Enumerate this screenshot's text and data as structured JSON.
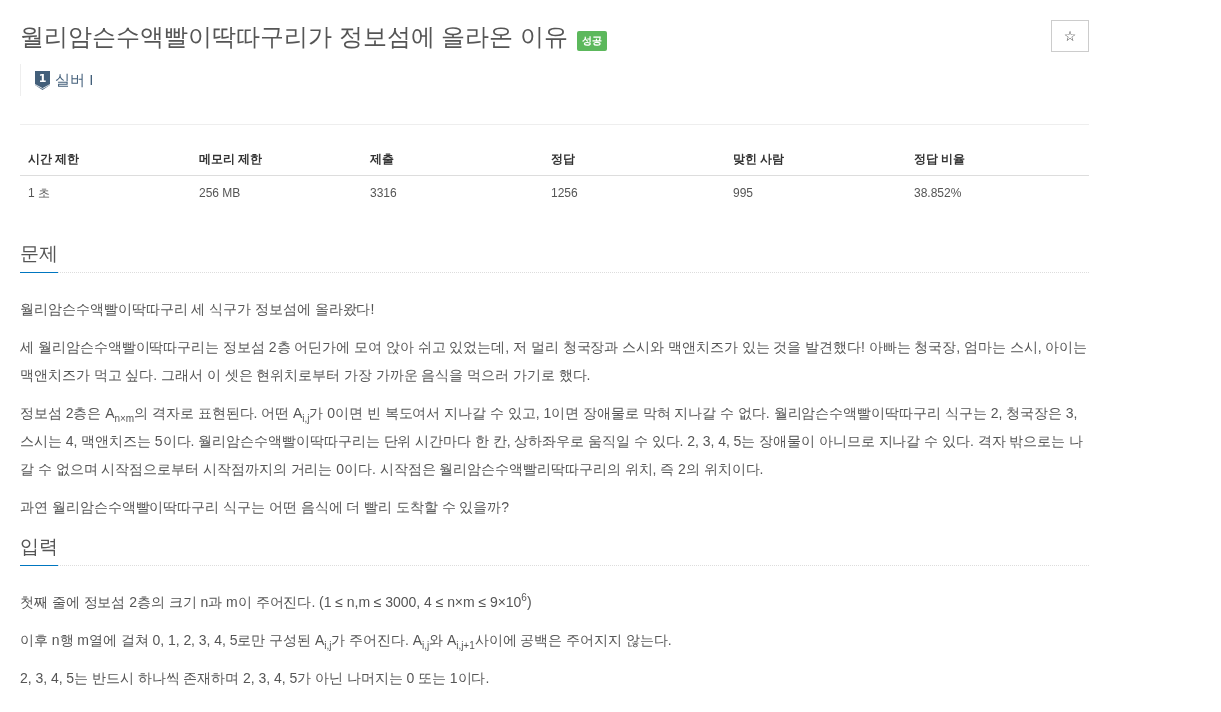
{
  "problem": {
    "title": "월리암슨수액빨이딱따구리가 정보섬에 올라온 이유",
    "result_badge": "성공",
    "star_button": "☆",
    "tier": {
      "number": "1",
      "label": "실버 I"
    }
  },
  "info_table": {
    "columns": [
      "시간 제한",
      "메모리 제한",
      "제출",
      "정답",
      "맞힌 사람",
      "정답 비율"
    ],
    "rows": [
      [
        "1 초",
        "256 MB",
        "3316",
        "1256",
        "995",
        "38.852%"
      ]
    ]
  },
  "sections": [
    {
      "heading": "문제",
      "paragraphs": [
        "월리암슨수액빨이딱따구리 세 식구가 정보섬에 올라왔다!",
        "세 월리암슨수액빨이딱따구리는 정보섬 2층 어딘가에 모여 앉아 쉬고 있었는데, 저 멀리 청국장과 스시와 맥앤치즈가 있는 것을 발견했다! 아빠는 청국장, 엄마는 스시, 아이는 맥앤치즈가 먹고 싶다. 그래서 이 셋은 현위치로부터 가장 가까운 음식을 먹으러 가기로 했다.",
        "정보섬 2층은 A$_{n×m}$의 격자로 표현된다. 어떤 A$_{i,j}$가 0이면 빈 복도여서 지나갈 수 있고, 1이면 장애물로 막혀 지나갈 수 없다. 월리암슨수액빨이딱따구리 식구는 2, 청국장은 3, 스시는 4, 맥앤치즈는 5이다. 월리암슨수액빨이딱따구리는 단위 시간마다 한 칸, 상하좌우로 움직일 수 있다. 2, 3, 4, 5는 장애물이 아니므로 지나갈 수 있다. 격자 밖으로는 나갈 수 없으며 시작점으로부터 시작점까지의 거리는 0이다. 시작점은 월리암슨수액빨리딱따구리의 위치, 즉 2의 위치이다.",
        "과연 월리암슨수액빨이딱따구리 식구는 어떤 음식에 더 빨리 도착할 수 있을까?"
      ]
    },
    {
      "heading": "입력",
      "paragraphs": [
        "첫째 줄에 정보섬 2층의 크기 n과 m이 주어진다. (1 ≤ n,m ≤ 3000, 4 ≤ n×m ≤ 9×10$^{6}$)",
        "이후 n행 m열에 걸쳐 0, 1, 2, 3, 4, 5로만 구성된 A$_{i,j}$가 주어진다. A$_{i,j}$와 A$_{i,j+1}$사이에 공백은 주어지지 않는다.",
        "2, 3, 4, 5는 반드시 하나씩 존재하며 2, 3, 4, 5가 아닌 나머지는 0 또는 1이다."
      ]
    }
  ]
}
